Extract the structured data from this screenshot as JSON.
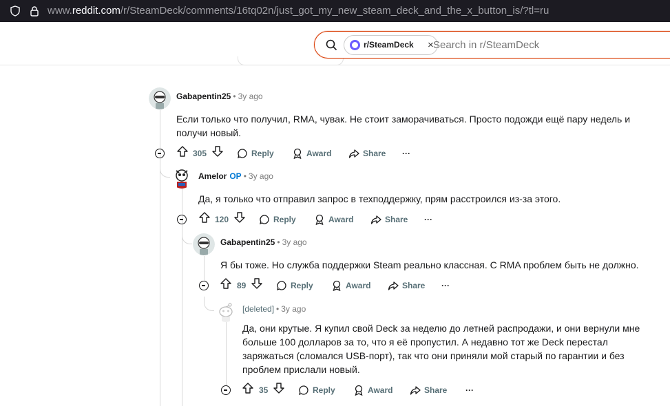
{
  "browser": {
    "url_prefix": "www.",
    "url_host": "reddit.com",
    "url_path": "/r/SteamDeck/comments/16tq02n/just_got_my_new_steam_deck_and_the_x_button_is/?tl=ru"
  },
  "search": {
    "community_chip": "r/SteamDeck",
    "chip_close": "×",
    "placeholder": "Search in r/SteamDeck"
  },
  "actions": {
    "reply": "Reply",
    "award": "Award",
    "share": "Share",
    "more": "···"
  },
  "comments": [
    {
      "author": "Gabapentin25",
      "op_badge": "",
      "separator": "•",
      "age": "3y ago",
      "body": "Если только что получил, RMA, чувак. Не стоит заморачиваться. Просто подожди ещё пару недель и получи новый.",
      "votes": "305"
    },
    {
      "author": "Amelor",
      "op_badge": "OP",
      "separator": "•",
      "age": "3y ago",
      "body": "Да, я только что отправил запрос в техподдержку, прям расстроился из-за этого.",
      "votes": "120"
    },
    {
      "author": "Gabapentin25",
      "op_badge": "",
      "separator": "•",
      "age": "3y ago",
      "body": "Я бы тоже. Но служба поддержки Steam реально классная. С RMA проблем быть не должно.",
      "votes": "89"
    },
    {
      "author": "[deleted]",
      "op_badge": "",
      "separator": "•",
      "age": "3y ago",
      "body": "Да, они крутые. Я купил свой Deck за неделю до летней распродажи, и они вернули мне больше 100 долларов за то, что я её пропустил. А недавно тот же Deck перестал заряжаться (сломался USB-порт), так что они приняли мой старый по гарантии и без проблем прислали новый.",
      "votes": "35"
    }
  ]
}
